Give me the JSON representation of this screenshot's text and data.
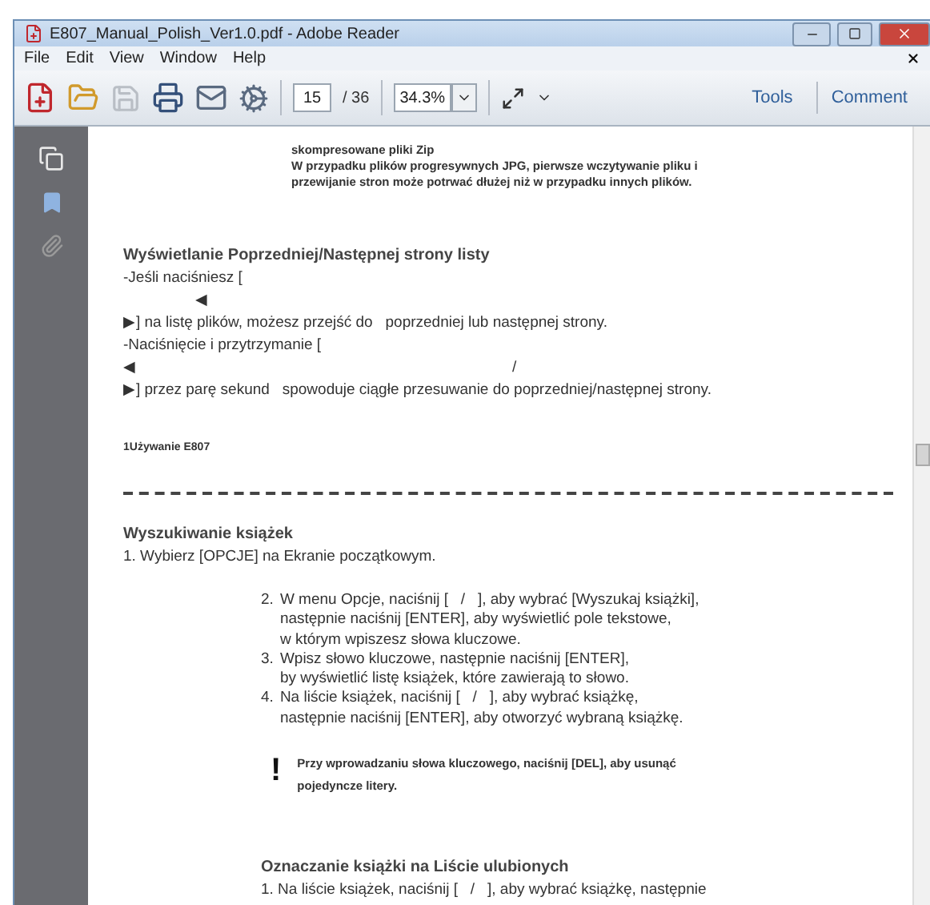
{
  "window": {
    "title": "E807_Manual_Polish_Ver1.0.pdf - Adobe Reader"
  },
  "menu": [
    "File",
    "Edit",
    "View",
    "Window",
    "Help"
  ],
  "toolbar": {
    "page": "15",
    "page_count": "/ 36",
    "zoom": "34.3%",
    "buttons": [
      "Tools",
      "Comment"
    ]
  },
  "document": {
    "pages": [
      {
        "blocks": [
          {
            "kind": "intro",
            "lines": [
              "skompresowane pliki Zip",
              "W przypadku plików progresywnych JPG, pierwsze wczytywanie pliku i",
              "przewijanie stron może potrwać dłużej niż w przypadku innych plików."
            ]
          },
          {
            "kind": "heading",
            "text": "Wyświetlanie Poprzedniej/Następnej strony listy"
          },
          {
            "kind": "line",
            "text": "-Jeśli naciśniesz ["
          },
          {
            "kind": "arrow-under",
            "parts": [
              "◀"
            ]
          },
          {
            "kind": "line",
            "text": "▶] na listę plików, możesz przejść do   poprzedniej lub następnej strony."
          },
          {
            "kind": "line",
            "text": "-Naciśnięcie i przytrzymanie ["
          },
          {
            "kind": "arrow-split",
            "parts": [
              "◀",
              "/"
            ]
          },
          {
            "kind": "line",
            "text": "▶] przez parę sekund   spowoduje ciągłe przesuwanie do poprzedniej/następnej strony."
          },
          {
            "kind": "footer",
            "text": "1Używanie E807"
          }
        ]
      },
      {
        "blocks": [
          {
            "kind": "heading",
            "text": "Wyszukiwanie książek"
          },
          {
            "kind": "line",
            "text": "1. Wybierz [OPCJE] na Ekranie początkowym."
          },
          {
            "kind": "steps",
            "items": [
              {
                "number": "2.",
                "lines": [
                  "W menu Opcje, naciśnij [   /   ], aby wybrać [Wyszukaj książki],",
                  "następnie naciśnij [ENTER], aby wyświetlić pole tekstowe,",
                  "w którym wpiszesz słowa kluczowe."
                ]
              },
              {
                "number": "3.",
                "lines": [
                  "Wpisz słowo kluczowe, następnie naciśnij [ENTER],",
                  "by wyświetlić listę książek, które zawierają to słowo."
                ]
              },
              {
                "number": "4.",
                "lines": [
                  "Na liście książek, naciśnij [   /   ], aby wybrać książkę,",
                  "następnie naciśnij [ENTER], aby otworzyć wybraną książkę."
                ]
              }
            ]
          },
          {
            "kind": "note",
            "mark": "!",
            "lines": [
              "Przy wprowadzaniu słowa kluczowego, naciśnij [DEL], aby usunąć",
              "pojedyncze litery."
            ]
          },
          {
            "kind": "indented-heading",
            "text": "Oznaczanie książki na Liście ulubionych"
          },
          {
            "kind": "indented-line",
            "text": "1. Na liście książek, naciśnij [   /   ], aby wybrać książkę, następnie"
          }
        ]
      }
    ]
  }
}
